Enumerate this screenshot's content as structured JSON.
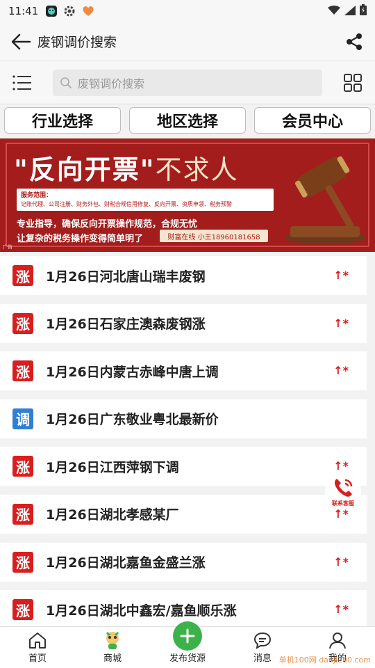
{
  "status_bar": {
    "time": "11:41"
  },
  "header": {
    "title": "废钢调价搜索"
  },
  "search": {
    "placeholder": "废钢调价搜索"
  },
  "filters": [
    {
      "label": "行业选择"
    },
    {
      "label": "地区选择"
    },
    {
      "label": "会员中心"
    }
  ],
  "banner": {
    "headline_quoted": "\"反向开票\"",
    "headline_rest": "不求人",
    "services_title": "服务范围：",
    "services": "记账代理、公司注册、财务外包、财税合规信用修复、反向开票、资质申领、税务预警",
    "line1": "专业指导，确保反向开票操作规范，合规无忧",
    "line2": "让复杂的税务操作变得简单明了",
    "contact": "财富在线  小王18960181658",
    "ad_label": "广告"
  },
  "list": [
    {
      "badge": "涨",
      "type": "up",
      "title": "1月26日河北唐山瑞丰废钢",
      "trend": "↑*"
    },
    {
      "badge": "涨",
      "type": "up",
      "title": "1月26日石家庄澳森废钢涨",
      "trend": "↑*"
    },
    {
      "badge": "涨",
      "type": "up",
      "title": "1月26日内蒙古赤峰中唐上调",
      "trend": "↑*"
    },
    {
      "badge": "调",
      "type": "adj",
      "title": "1月26日广东敬业粤北最新价",
      "trend": ""
    },
    {
      "badge": "涨",
      "type": "up",
      "title": "1月26日江西萍钢下调",
      "trend": "↑*"
    },
    {
      "badge": "涨",
      "type": "up",
      "title": "1月26日湖北孝感某厂",
      "trend": "↑*"
    },
    {
      "badge": "涨",
      "type": "up",
      "title": "1月26日湖北嘉鱼金盛兰涨",
      "trend": "↑*"
    },
    {
      "badge": "涨",
      "type": "up",
      "title": "1月26日湖北中鑫宏/嘉鱼顺乐涨",
      "trend": "↑*"
    }
  ],
  "float_contact": {
    "label": "联系客服"
  },
  "nav": [
    {
      "label": "首页",
      "icon": "home-icon"
    },
    {
      "label": "商城",
      "icon": "mall-mascot-icon"
    },
    {
      "label": "发布货源",
      "icon": "plus-icon"
    },
    {
      "label": "消息",
      "icon": "message-icon"
    },
    {
      "label": "我的",
      "icon": "user-icon"
    }
  ],
  "watermark": "单机100网 danji100.com",
  "colors": {
    "accent_red": "#d81e1e",
    "adjust_blue": "#2f7fd6",
    "publish_green": "#3bb34a",
    "banner_red": "#a31d1d"
  }
}
